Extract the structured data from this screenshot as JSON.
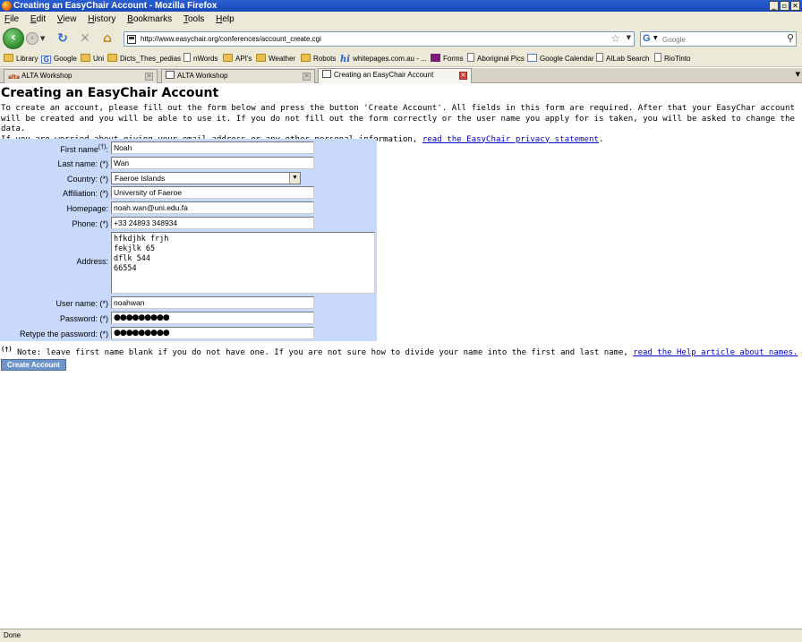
{
  "window": {
    "title": "Creating an EasyChair Account - Mozilla Firefox",
    "buttons": {
      "minimize": "_",
      "maximize": "▫",
      "close": "✕"
    }
  },
  "menu": [
    "File",
    "Edit",
    "View",
    "History",
    "Bookmarks",
    "Tools",
    "Help"
  ],
  "nav": {
    "url": "http://www.easychair.org/conferences/account_create.cgi",
    "search_placeholder": "Google",
    "search_engine_letter": "G"
  },
  "bookmarks": [
    {
      "label": "Library",
      "icon": "folder"
    },
    {
      "label": "Google",
      "icon": "google"
    },
    {
      "label": "Uni",
      "icon": "folder"
    },
    {
      "label": "Dicts_Thes_pedias",
      "icon": "folder"
    },
    {
      "label": "nWords",
      "icon": "page"
    },
    {
      "label": "API's",
      "icon": "folder"
    },
    {
      "label": "Weather",
      "icon": "folder"
    },
    {
      "label": "Robots",
      "icon": "folder"
    },
    {
      "label": "whitepages.com.au - ...",
      "icon": "hi"
    },
    {
      "label": "Forms",
      "icon": "forms"
    },
    {
      "label": "Aboriginal Pics",
      "icon": "page"
    },
    {
      "label": "Google Calendar",
      "icon": "calendar"
    },
    {
      "label": "AILab Search",
      "icon": "page"
    },
    {
      "label": "RioTinto",
      "icon": "page"
    }
  ],
  "tabs": [
    {
      "label": "ALTA Workshop",
      "icon": "alta",
      "active": false
    },
    {
      "label": "ALTA Workshop",
      "icon": "page",
      "active": false
    },
    {
      "label": "Creating an EasyChair Account",
      "icon": "page",
      "active": true
    }
  ],
  "page": {
    "title": "Creating an EasyChair Account",
    "intro1": "To create an account, please fill out the form below and press the button 'Create Account'. All fields in this form are required. After that your EasyChar account will be created and you will be able to use it. If you do not fill out the form correctly or the user name you apply for is taken, you will be asked to change the data.",
    "intro2": "If you are worried about giving your email address or any other personal information,",
    "privacy_link": "read the EasyChair privacy statement",
    "intro2_end": "."
  },
  "form": {
    "first_name": {
      "label": "First name",
      "sup": "(†)",
      "value": "Noah"
    },
    "last_name": {
      "label": "Last name: (*)",
      "value": "Wan"
    },
    "country": {
      "label": "Country: (*)",
      "value": "Faeroe Islands"
    },
    "affiliation": {
      "label": "Affiliation: (*)",
      "value": "University of Faeroe"
    },
    "homepage": {
      "label": "Homepage:",
      "value": "noah.wan@uni.edu.fa"
    },
    "phone": {
      "label": "Phone: (*)",
      "value": "+33 24893 348934"
    },
    "address": {
      "label": "Address:",
      "value": "hfkdjhk frjh\nfekjlk 65\ndflk 544\n66554"
    },
    "username": {
      "label": "User name: (*)",
      "value": "noahwan"
    },
    "password": {
      "label": "Password: (*)",
      "value": "●●●●●●●●●"
    },
    "retype": {
      "label": "Retype the password: (*)",
      "value": "●●●●●●●●●"
    }
  },
  "note": {
    "sup": "(†)",
    "text": " Note: leave first name blank if you do not have one. If you are not sure how to divide your name into the first and last name, ",
    "link": "read the Help article about names."
  },
  "create_button": "Create Account",
  "status": "Done"
}
